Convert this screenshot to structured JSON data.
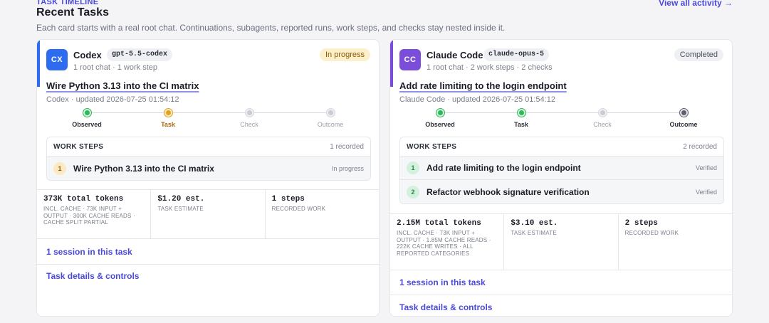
{
  "header": {
    "kicker": "TASK TIMELINE",
    "title": "Recent Tasks",
    "subtitle": "Each card starts with a real root chat. Continuations, subagents, reported runs, work steps, and checks stay nested inside it.",
    "view_all": "View all activity →"
  },
  "cards": [
    {
      "icon_text": "CX",
      "icon_color": "#2d6cf0",
      "accent_color": "#2d6cf0",
      "agent": "Codex",
      "model": "gpt-5.5-codex",
      "meta": "1 root chat · 1 work step",
      "status": "In progress",
      "task_title": "Wire Python 3.13 into the CI matrix",
      "updated": "Codex · updated 2026-07-25 01:54:12",
      "timeline": [
        {
          "label": "Observed",
          "state": "green"
        },
        {
          "label": "Task",
          "state": "amber"
        },
        {
          "label": "Check",
          "state": "grey"
        },
        {
          "label": "Outcome",
          "state": "grey"
        }
      ],
      "steps_title": "WORK STEPS",
      "steps_count": "1 recorded",
      "steps": [
        {
          "num": "1",
          "label": "Wire Python 3.13 into the CI matrix",
          "status": "In progress"
        }
      ],
      "stats": [
        {
          "value": "373K total tokens",
          "sub": "INCL. CACHE · 73K INPUT + OUTPUT · 300K CACHE READS · CACHE SPLIT PARTIAL"
        },
        {
          "value": "$1.20 est.",
          "sub": "TASK ESTIMATE"
        },
        {
          "value": "1 steps",
          "sub": "RECORDED WORK"
        }
      ],
      "session_link": "1 session in this task",
      "details_link": "Task details & controls"
    },
    {
      "icon_text": "CC",
      "icon_color": "#7c4ddb",
      "accent_color": "#7c4ddb",
      "agent": "Claude Code",
      "model": "claude-opus-5",
      "meta": "1 root chat · 2 work steps · 2 checks",
      "status": "Completed",
      "task_title": "Add rate limiting to the login endpoint",
      "updated": "Claude Code · updated 2026-07-25 01:54:12",
      "timeline": [
        {
          "label": "Observed",
          "state": "green"
        },
        {
          "label": "Task",
          "state": "green"
        },
        {
          "label": "Check",
          "state": "grey"
        },
        {
          "label": "Outcome",
          "state": "dark"
        }
      ],
      "steps_title": "WORK STEPS",
      "steps_count": "2 recorded",
      "steps": [
        {
          "num": "1",
          "label": "Add rate limiting to the login endpoint",
          "status": "Verified"
        },
        {
          "num": "2",
          "label": "Refactor webhook signature verification",
          "status": "Verified"
        }
      ],
      "stats": [
        {
          "value": "2.15M total tokens",
          "sub": "INCL. CACHE · 73K INPUT + OUTPUT · 1.85M CACHE READS · 222K CACHE WRITES · ALL REPORTED CATEGORIES"
        },
        {
          "value": "$3.10 est.",
          "sub": "TASK ESTIMATE"
        },
        {
          "value": "2 steps",
          "sub": "RECORDED WORK"
        }
      ],
      "session_link": "1 session in this task",
      "details_link": "Task details & controls"
    }
  ]
}
